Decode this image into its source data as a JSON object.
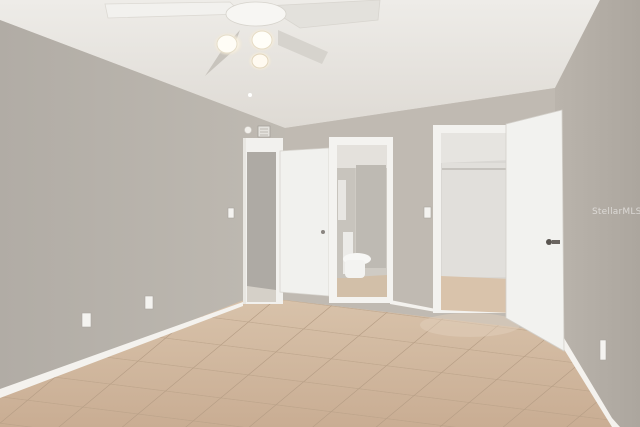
{
  "photo": {
    "subject": "empty-bedroom",
    "watermark": "StellarMLS",
    "colors": {
      "wall": "#b8b2aa",
      "ceiling": "#e6e3de",
      "floor": "#cdb39a",
      "door": "#f1f1ee",
      "baseboard": "#f4f2ee"
    }
  }
}
